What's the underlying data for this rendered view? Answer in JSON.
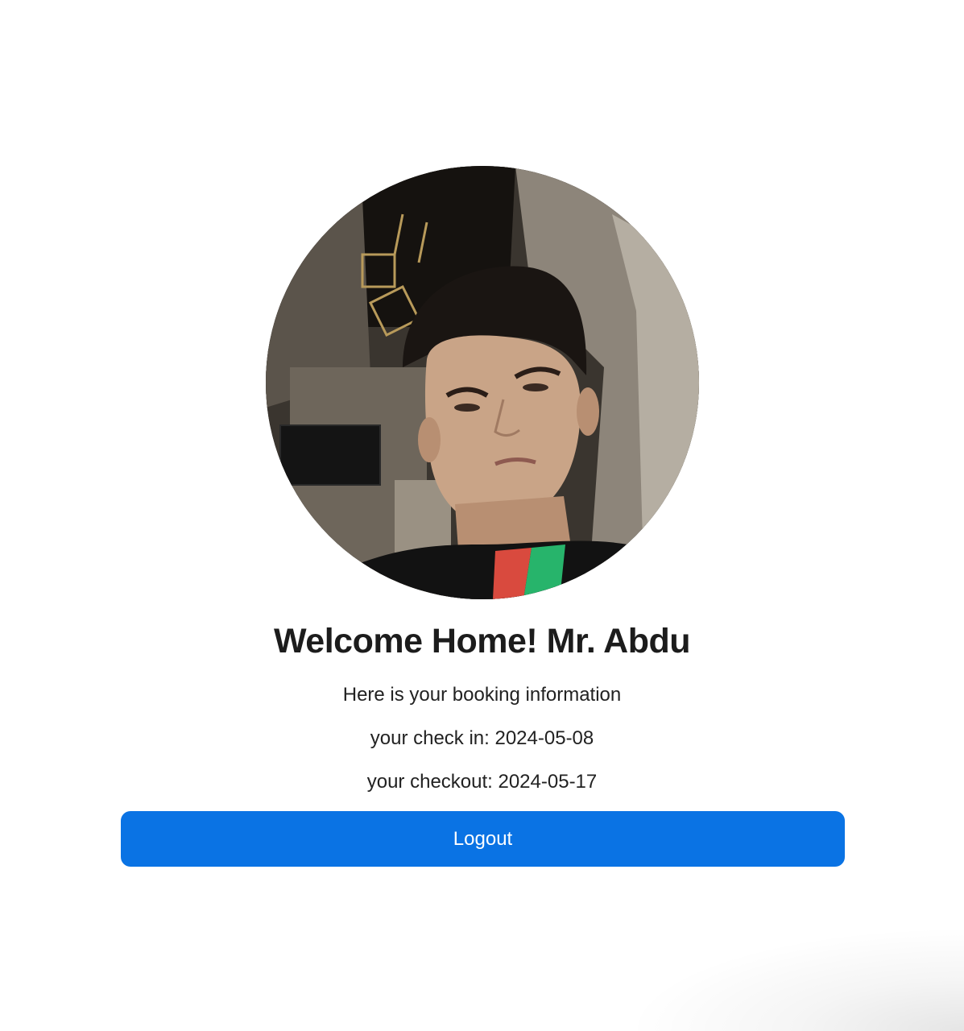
{
  "profile": {
    "avatar_description_icon": "user-photo-avatar"
  },
  "greeting": {
    "title": "Welcome Home! Mr. Abdu"
  },
  "booking": {
    "intro": "Here is your booking information",
    "check_in": "your check in: 2024-05-08",
    "checkout": "your checkout: 2024-05-17"
  },
  "actions": {
    "logout_label": "Logout"
  },
  "colors": {
    "accent": "#0a73e4",
    "text": "#1c1c1c",
    "background": "#ffffff"
  }
}
